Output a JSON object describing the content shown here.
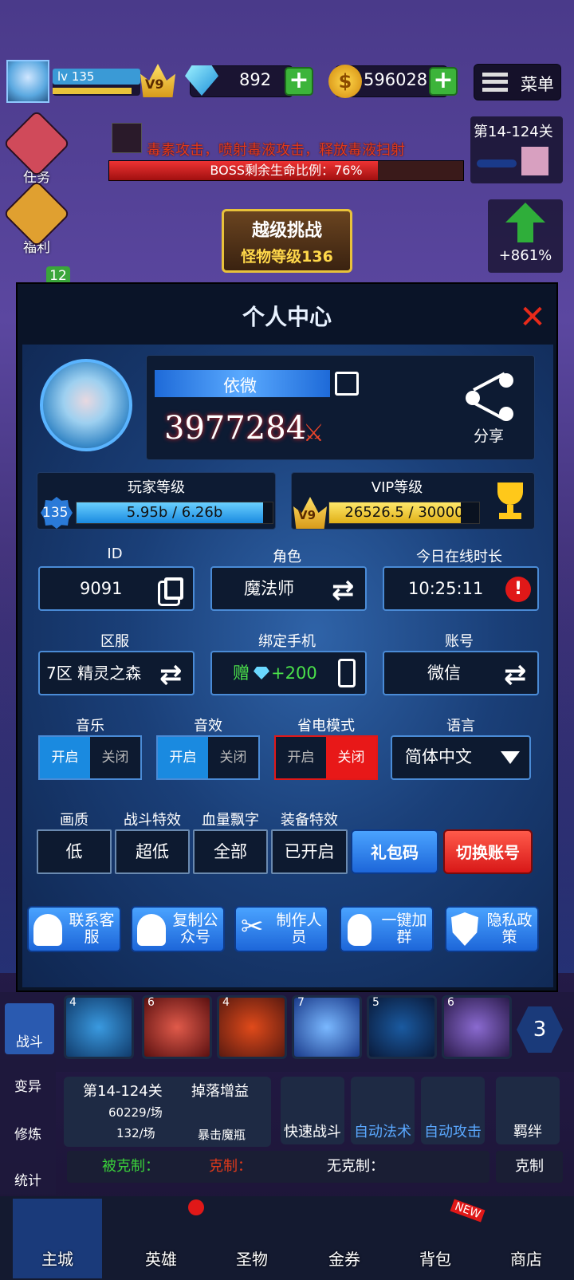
{
  "top": {
    "level": "lv 135",
    "vip": "V9",
    "gems": "892",
    "coins": "596028",
    "menu": "菜单"
  },
  "side": {
    "task": "任务",
    "welfare": "福利",
    "count": "12"
  },
  "boss": {
    "skill": "毒素攻击，喷射毒液攻击，释放毒液扫射",
    "hp": "BOSS剩余生命比例：76%",
    "hp_pct": 76
  },
  "stage": {
    "label": "第14-124关",
    "exp": "+861%"
  },
  "challenge": {
    "title": "越级挑战",
    "sub": "怪物等级136"
  },
  "modal": {
    "title": "个人中心",
    "name": "依微",
    "power": "3977284",
    "share": "分享",
    "player_level_label": "玩家等级",
    "player_level": "135",
    "player_exp": "5.95b / 6.26b",
    "player_pct": 95,
    "vip_label": "VIP等级",
    "vip": "V9",
    "vip_exp": "26526.5 / 30000",
    "vip_pct": 88,
    "id_label": "ID",
    "id": "9091",
    "role_label": "角色",
    "role": "魔法师",
    "online_label": "今日在线时长",
    "online": "10:25:11",
    "server_label": "区服",
    "server": "7区 精灵之森",
    "phone_label": "绑定手机",
    "phone_gift": "赠",
    "phone_reward": "+200",
    "account_label": "账号",
    "account": "微信",
    "music_label": "音乐",
    "sfx_label": "音效",
    "power_label": "省电模式",
    "lang_label": "语言",
    "on": "开启",
    "off": "关闭",
    "lang": "简体中文",
    "quality_label": "画质",
    "quality": "低",
    "fx_label": "战斗特效",
    "fx": "超低",
    "dmg_label": "血量飘字",
    "dmg": "全部",
    "equip_label": "装备特效",
    "equip": "已开启",
    "gift_code": "礼包码",
    "switch_account": "切换账号",
    "b1": "联系客服",
    "b2": "复制公众号",
    "b3": "制作人员",
    "b4": "一键加群",
    "b5": "隐私政策"
  },
  "skills": {
    "levels": [
      "4",
      "6",
      "4",
      "7",
      "5",
      "6"
    ],
    "count": "3"
  },
  "left_nav": [
    "战斗",
    "变异",
    "修炼",
    "统计"
  ],
  "info": {
    "stage": "第14-124关",
    "exp_rate": "60229/场",
    "gold_rate": "132/场",
    "drop": "掉落增益",
    "item": "暴击魔瓶"
  },
  "actions": [
    "快速战斗",
    "自动法术",
    "自动攻击",
    "羁绊"
  ],
  "counter": {
    "weak": "被克制：",
    "strong": "克制：",
    "none": "无克制：",
    "btn": "克制"
  },
  "tabs": [
    "主城",
    "英雄",
    "圣物",
    "金券",
    "背包",
    "商店"
  ],
  "new_badge": "NEW"
}
